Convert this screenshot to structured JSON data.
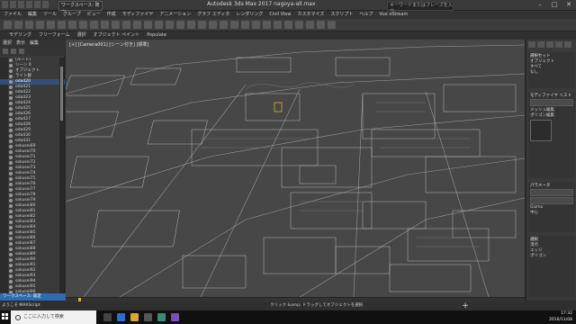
{
  "window": {
    "title": "Autodesk 3ds Max 2017    nagoya-all.max",
    "workspace": "ワークスペース: 既定",
    "search_placeholder": "キーワードまたはフレーズを入力",
    "controls": [
      "–",
      "□",
      "✕"
    ]
  },
  "menu": [
    "ファイル",
    "編集",
    "ツール",
    "グループ",
    "ビュー",
    "作成",
    "モディファイヤ",
    "アニメーション",
    "グラフ エディタ",
    "レンダリング",
    "Civil View",
    "カスタマイズ",
    "スクリプト",
    "ヘルプ",
    "Vue xStream"
  ],
  "ribbon": [
    "モデリング",
    "フリーフォーム",
    "選択",
    "オブジェクト ペイント",
    "Populate"
  ],
  "scene_explorer": {
    "tabs": [
      "選択",
      "表示",
      "編集"
    ],
    "items": [
      {
        "label": "(ルート)",
        "selected": false
      },
      {
        "label": "シーン 0",
        "selected": false
      },
      {
        "label": "オブジェクト",
        "selected": false
      },
      {
        "label": "ライト群",
        "selected": false
      },
      {
        "label": "oda420",
        "selected": true
      },
      {
        "label": "oda421",
        "selected": false
      },
      {
        "label": "oda422",
        "selected": false
      },
      {
        "label": "oda423",
        "selected": false
      },
      {
        "label": "oda424",
        "selected": false
      },
      {
        "label": "oda425",
        "selected": false
      },
      {
        "label": "oda426",
        "selected": false
      },
      {
        "label": "oda427",
        "selected": false
      },
      {
        "label": "oda428",
        "selected": false
      },
      {
        "label": "oda429",
        "selected": false
      },
      {
        "label": "oda430",
        "selected": false
      },
      {
        "label": "oda431",
        "selected": false
      },
      {
        "label": "sokusei69",
        "selected": false
      },
      {
        "label": "sokusei70",
        "selected": false
      },
      {
        "label": "sokusei71",
        "selected": false
      },
      {
        "label": "sokusei72",
        "selected": false
      },
      {
        "label": "sokusei73",
        "selected": false
      },
      {
        "label": "sokusei74",
        "selected": false
      },
      {
        "label": "sokusei75",
        "selected": false
      },
      {
        "label": "sokusei76",
        "selected": false
      },
      {
        "label": "sokusei77",
        "selected": false
      },
      {
        "label": "sokusei78",
        "selected": false
      },
      {
        "label": "sokusei79",
        "selected": false
      },
      {
        "label": "sokusei80",
        "selected": false
      },
      {
        "label": "sokusei81",
        "selected": false
      },
      {
        "label": "sokusei82",
        "selected": false
      },
      {
        "label": "sokusei83",
        "selected": false
      },
      {
        "label": "sokusei84",
        "selected": false
      },
      {
        "label": "sokusei85",
        "selected": false
      },
      {
        "label": "sokusei86",
        "selected": false
      },
      {
        "label": "sokusei87",
        "selected": false
      },
      {
        "label": "sokusei88",
        "selected": false
      },
      {
        "label": "sokusei89",
        "selected": false
      },
      {
        "label": "sokusei90",
        "selected": false
      },
      {
        "label": "sokusei91",
        "selected": false
      },
      {
        "label": "sokusei92",
        "selected": false
      },
      {
        "label": "sokusei93",
        "selected": false
      },
      {
        "label": "sokusei94",
        "selected": false
      },
      {
        "label": "sokusei95",
        "selected": false
      },
      {
        "label": "sokusei96",
        "selected": false
      }
    ],
    "bottom": "ワークスペース: 既定"
  },
  "viewport": {
    "label": "[+] [Camera001] [シーン付き] [標準]"
  },
  "command_panel": {
    "sections": [
      {
        "title": "選択セット",
        "lines": [
          "オブジェクト",
          "すべて",
          "なし"
        ]
      },
      {
        "title": "モディファイヤ リスト",
        "lines": [
          "メッシュ編集",
          "ポリゴン編集"
        ]
      },
      {
        "title": "パラメータ",
        "lines": [
          "Gizmo",
          "中心"
        ]
      },
      {
        "title": "選択",
        "lines": [
          "頂点",
          "エッジ",
          "ポリゴン"
        ]
      }
    ]
  },
  "status": {
    "left": "ようこそ MAXScript",
    "prompt": "クリック &amp; ドラッグしてオブジェクトを選択"
  },
  "taskbar": {
    "search": "ここに入力して検索",
    "time": "17:32",
    "date": "2016/11/08"
  },
  "colors": {
    "selection": "#34507a",
    "accent": "#2e6bb0",
    "viewport_bg": "#474747"
  }
}
